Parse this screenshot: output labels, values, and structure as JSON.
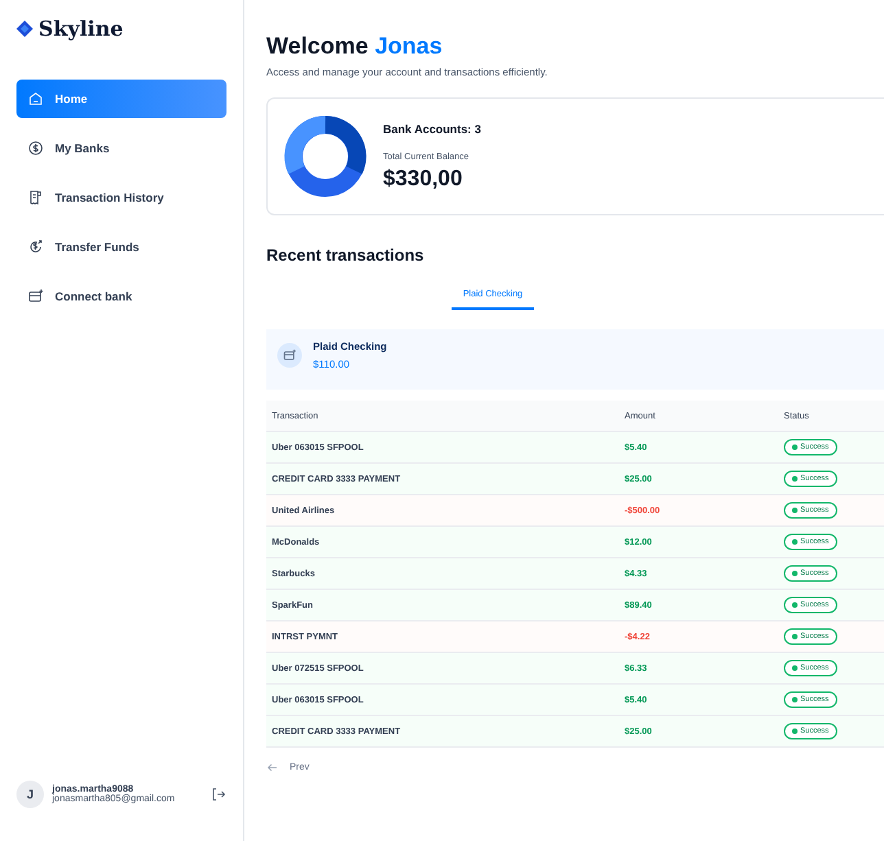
{
  "brand": {
    "name": "Skyline"
  },
  "sidebar": {
    "items": [
      {
        "label": "Home",
        "selected": true
      },
      {
        "label": "My Banks",
        "selected": false
      },
      {
        "label": "Transaction History",
        "selected": false
      },
      {
        "label": "Transfer Funds",
        "selected": false
      },
      {
        "label": "Connect bank",
        "selected": false
      }
    ]
  },
  "user": {
    "initial": "J",
    "name": "jonas.martha9088",
    "email": "jonasmartha805@gmail.com"
  },
  "header": {
    "greeting": "Welcome",
    "name": "Jonas",
    "subtitle": "Access and manage your account and transactions efficiently."
  },
  "balance": {
    "accounts": "Bank Accounts: 3",
    "label": "Total Current Balance",
    "amount": "$330,00"
  },
  "recent": {
    "title": "Recent transactions",
    "tabs": [
      {
        "label": "Plaid Checking",
        "selected": true
      }
    ],
    "account": {
      "name": "Plaid Checking",
      "balance": "$110.00"
    },
    "columns": [
      "Transaction",
      "Amount",
      "Status"
    ],
    "rows": [
      {
        "name": "Uber 063015 SFPOOL",
        "amount": "$5.40",
        "kind": "credit",
        "status": "Success"
      },
      {
        "name": "CREDIT CARD 3333 PAYMENT",
        "amount": "$25.00",
        "kind": "credit",
        "status": "Success"
      },
      {
        "name": "United Airlines",
        "amount": "-$500.00",
        "kind": "debit",
        "status": "Success"
      },
      {
        "name": "McDonalds",
        "amount": "$12.00",
        "kind": "credit",
        "status": "Success"
      },
      {
        "name": "Starbucks",
        "amount": "$4.33",
        "kind": "credit",
        "status": "Success"
      },
      {
        "name": "SparkFun",
        "amount": "$89.40",
        "kind": "credit",
        "status": "Success"
      },
      {
        "name": "INTRST PYMNT",
        "amount": "-$4.22",
        "kind": "debit",
        "status": "Success"
      },
      {
        "name": "Uber 072515 SFPOOL",
        "amount": "$6.33",
        "kind": "credit",
        "status": "Success"
      },
      {
        "name": "Uber 063015 SFPOOL",
        "amount": "$5.40",
        "kind": "credit",
        "status": "Success"
      },
      {
        "name": "CREDIT CARD 3333 PAYMENT",
        "amount": "$25.00",
        "kind": "credit",
        "status": "Success"
      }
    ],
    "pagination": {
      "prev": "Prev"
    }
  }
}
